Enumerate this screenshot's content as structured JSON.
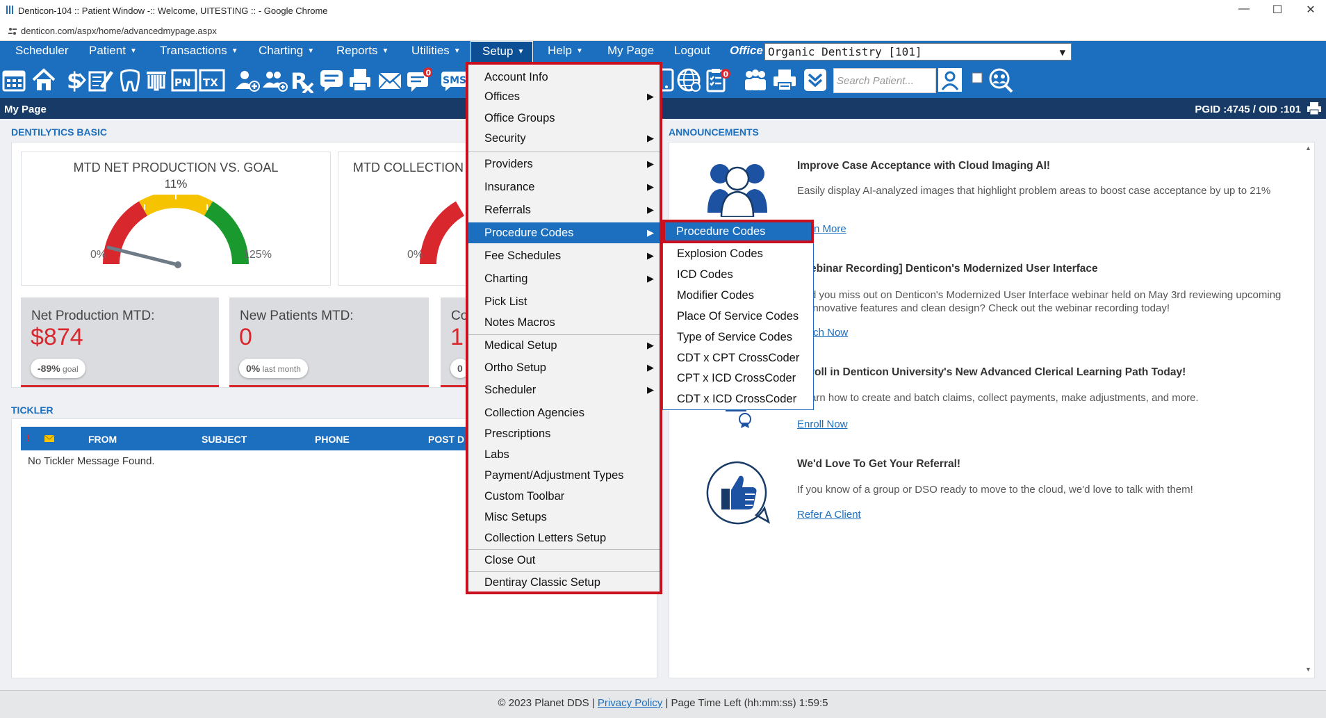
{
  "browser": {
    "title": "Denticon-104 :: Patient Window -:: Welcome, UITESTING :: - Google Chrome",
    "url": "denticon.com/aspx/home/advancedmypage.aspx"
  },
  "menubar": {
    "items": [
      "Scheduler",
      "Patient",
      "Transactions",
      "Charting",
      "Reports",
      "Utilities",
      "Setup",
      "Help",
      "My Page",
      "Logout"
    ],
    "office_label": "Office",
    "office_value": "Organic Dentistry [101]"
  },
  "toolbar": {
    "search_placeholder": "Search Patient...",
    "badge": "0",
    "sms_label": "SMS",
    "icons": [
      "calendar-icon",
      "home-icon",
      "dollar-icon",
      "edit-icon",
      "tooth-icon",
      "teeth-icon",
      "pn-icon",
      "tx-icon",
      "patient-add-icon",
      "group-add-icon",
      "rx-icon",
      "message-icon",
      "printer-icon",
      "mail-icon",
      "chat-icon",
      "sms-icon",
      "mobile-icon",
      "globe-icon",
      "clipboard-icon",
      "people-icon",
      "print-icon",
      "download-icon",
      "user-search-icon",
      "checkbox-icon",
      "team-search-icon"
    ]
  },
  "pagebar": {
    "title": "My Page",
    "ids": "PGID :4745  /  OID :101"
  },
  "dentilytics": {
    "title": "DENTILYTICS BASIC",
    "gauge1": {
      "title": "MTD NET PRODUCTION VS. GOAL",
      "percent": "11%",
      "min": "0%",
      "max": "125%",
      "value_fraction": 0.088
    },
    "gauge2": {
      "title": "MTD COLLECTION",
      "min": "0%"
    },
    "stats": [
      {
        "label": "Net Production MTD:",
        "value": "$874",
        "pill_value": "-89%",
        "pill_text": "goal"
      },
      {
        "label": "New Patients MTD:",
        "value": "0",
        "pill_value": "0%",
        "pill_text": "last month"
      },
      {
        "label": "Co",
        "value": "1",
        "pill_value": "0",
        "pill_text": ""
      }
    ]
  },
  "tickler": {
    "title": "TICKLER",
    "columns": [
      "FROM",
      "SUBJECT",
      "PHONE",
      "POST D"
    ],
    "empty": "No Tickler Message Found."
  },
  "announcements": {
    "title": "ANNOUNCEMENTS",
    "items": [
      {
        "title": "Improve Case Acceptance with Cloud Imaging AI!",
        "body": "Easily display AI-analyzed images that highlight problem areas to boost case acceptance by up to 21%",
        "link": "rn More"
      },
      {
        "title": "ebinar Recording] Denticon's Modernized User Interface",
        "body": "d you miss out on Denticon's Modernized User Interface webinar held on May 3rd reviewing upcoming innovative features and clean design? Check out the webinar recording today!",
        "link": "tch Now"
      },
      {
        "title": "roll in Denticon University's New Advanced Clerical Learning Path Today!",
        "body": "arn how to create and batch claims, collect payments, make adjustments, and more.",
        "link": "Enroll Now"
      },
      {
        "title": "We'd Love To Get Your Referral!",
        "body": "If you know of a group or DSO ready to move to the cloud, we'd love to talk with them!",
        "link": "Refer A Client"
      }
    ]
  },
  "setup_menu": {
    "items": [
      {
        "label": "Account Info",
        "sub": false
      },
      {
        "label": "Offices",
        "sub": true
      },
      {
        "label": "Office Groups",
        "sub": false
      },
      {
        "label": "Security",
        "sub": true
      },
      {
        "label": "Providers",
        "sub": true
      },
      {
        "label": "Insurance",
        "sub": true
      },
      {
        "label": "Referrals",
        "sub": true
      },
      {
        "label": "Procedure Codes",
        "sub": true
      },
      {
        "label": "Fee Schedules",
        "sub": true
      },
      {
        "label": "Charting",
        "sub": true
      },
      {
        "label": "Pick List",
        "sub": false
      },
      {
        "label": "Notes Macros",
        "sub": false
      },
      {
        "label": "Medical Setup",
        "sub": true
      },
      {
        "label": "Ortho Setup",
        "sub": true
      },
      {
        "label": "Scheduler",
        "sub": true
      },
      {
        "label": "Collection Agencies",
        "sub": false
      },
      {
        "label": "Prescriptions",
        "sub": false
      },
      {
        "label": "Labs",
        "sub": false
      },
      {
        "label": "Payment/Adjustment Types",
        "sub": false
      },
      {
        "label": "Custom Toolbar",
        "sub": false
      },
      {
        "label": "Misc Setups",
        "sub": false
      },
      {
        "label": "Collection Letters Setup",
        "sub": false
      },
      {
        "label": "Close Out",
        "sub": false
      },
      {
        "label": "Dentiray Classic Setup",
        "sub": false
      }
    ]
  },
  "procedure_submenu": {
    "items": [
      "Procedure Codes",
      "Explosion Codes",
      "ICD Codes",
      "Modifier Codes",
      "Place Of Service Codes",
      "Type of Service Codes",
      "CDT x CPT CrossCoder",
      "CPT x ICD CrossCoder",
      "CDT x ICD CrossCoder"
    ]
  },
  "footer": {
    "copyright": "© 2023 Planet DDS |",
    "privacy": "Privacy Policy",
    "time_left": "| Page Time Left (hh:mm:ss) 1:59:5"
  },
  "colors": {
    "brand_blue": "#1c6fbf",
    "dark_navy": "#173b66",
    "highlight_red": "#c8101e"
  }
}
